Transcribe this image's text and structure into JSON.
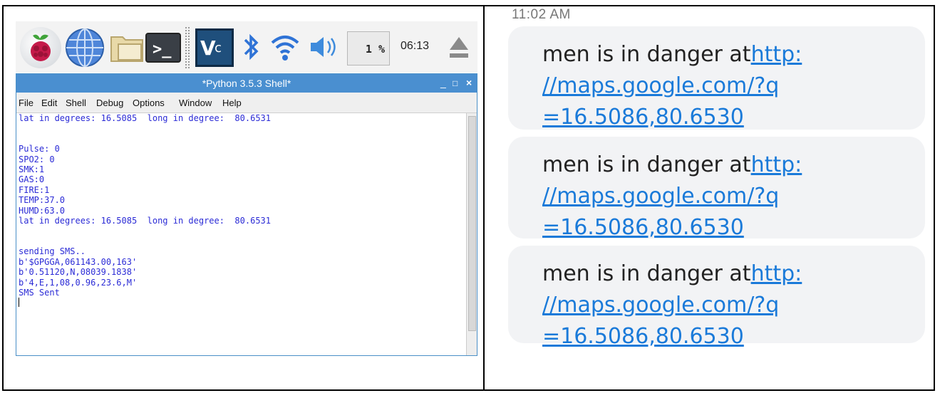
{
  "taskbar": {
    "cpu": "1 %",
    "clock": "06:13"
  },
  "window": {
    "title": "*Python 3.5.3 Shell*",
    "controls": [
      "_",
      "□",
      "×"
    ],
    "menu": [
      "File",
      "Edit",
      "Shell",
      "Debug",
      "Options",
      "Window",
      "Help"
    ]
  },
  "shell_lines": [
    "lat in degrees: 16.5085  long in degree:  80.6531",
    "",
    "",
    "Pulse: 0",
    "SPO2: 0",
    "SMK:1",
    "GAS:0",
    "FIRE:1",
    "TEMP:37.0",
    "HUMD:63.0",
    "lat in degrees: 16.5085  long in degree:  80.6531",
    "",
    "",
    "sending SMS..",
    "b'$GPGGA,061143.00,163'",
    "b'0.51120,N,08039.1838'",
    "b'4,E,1,08,0.96,23.6,M'",
    "SMS Sent"
  ],
  "sms": {
    "time": "11:02 AM",
    "messages": [
      {
        "text": "men is in danger at",
        "link_1": "http:",
        "link_2": "//maps.google.com/?q",
        "link_3": "=16.5086,80.6530"
      },
      {
        "text": "men is in danger at",
        "link_1": "http:",
        "link_2": "//maps.google.com/?q",
        "link_3": "=16.5086,80.6530"
      },
      {
        "text": "men is in danger at",
        "link_1": "http:",
        "link_2": "//maps.google.com/?q",
        "link_3": "=16.5086,80.6530"
      }
    ]
  },
  "colors": {
    "titlebar": "#4a8fd0",
    "shell_text": "#2b2bd6",
    "link": "#1a7ad9",
    "bubble": "#f2f3f5"
  }
}
